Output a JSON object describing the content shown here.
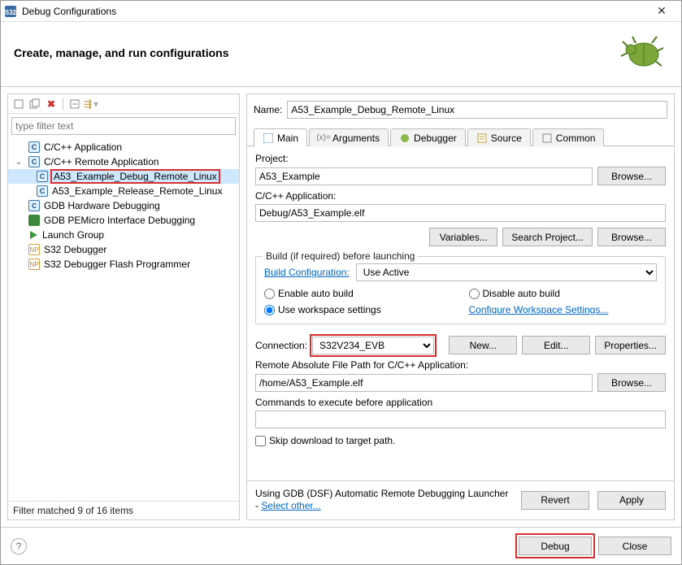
{
  "window": {
    "title": "Debug Configurations"
  },
  "header": {
    "title": "Create, manage, and run configurations"
  },
  "left": {
    "filter_placeholder": "type filter text",
    "nodes": {
      "cpp_app": "C/C++ Application",
      "cpp_remote": "C/C++ Remote Application",
      "a53_debug": "A53_Example_Debug_Remote_Linux",
      "a53_release": "A53_Example_Release_Remote_Linux",
      "gdb_hw": "GDB Hardware Debugging",
      "gdb_pe": "GDB PEMicro Interface Debugging",
      "launch_group": "Launch Group",
      "s32_dbg": "S32 Debugger",
      "s32_flash": "S32 Debugger Flash Programmer"
    },
    "filter_status": "Filter matched 9 of 16 items"
  },
  "right": {
    "name_label": "Name:",
    "name_value": "A53_Example_Debug_Remote_Linux",
    "tabs": {
      "main": "Main",
      "arguments": "Arguments",
      "debugger": "Debugger",
      "source": "Source",
      "common": "Common"
    },
    "project_label": "Project:",
    "project_value": "A53_Example",
    "browse": "Browse...",
    "cpp_app_label": "C/C++ Application:",
    "cpp_app_value": "Debug/A53_Example.elf",
    "variables": "Variables...",
    "search_project": "Search Project...",
    "build_group": "Build (if required) before launching",
    "build_config_label": "Build Configuration:",
    "build_config_value": "Use Active",
    "enable_auto": "Enable auto build",
    "disable_auto": "Disable auto build",
    "use_ws": "Use workspace settings",
    "conf_ws": "Configure Workspace Settings...",
    "conn_label": "Connection:",
    "conn_value": "S32V234_EVB",
    "new": "New...",
    "edit": "Edit...",
    "properties": "Properties...",
    "remote_path_label": "Remote Absolute File Path for C/C++ Application:",
    "remote_path_value": "/home/A53_Example.elf",
    "cmds_label": "Commands to execute before application",
    "cmds_value": "",
    "skip_dl": "Skip download to target path.",
    "launcher_text": "Using GDB (DSF) Automatic Remote Debugging Launcher - ",
    "launcher_link": "Select other...",
    "revert": "Revert",
    "apply": "Apply"
  },
  "footer": {
    "debug": "Debug",
    "close": "Close"
  }
}
